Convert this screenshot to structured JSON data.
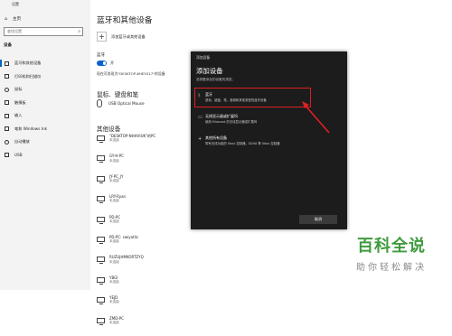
{
  "window": {
    "title": "设置"
  },
  "sidebar": {
    "home": "主页",
    "search_placeholder": "查找设置",
    "section": "设备",
    "items": [
      {
        "label": "蓝牙和其他设备",
        "active": true
      },
      {
        "label": "打印机和扫描仪"
      },
      {
        "label": "鼠标"
      },
      {
        "label": "触摸板"
      },
      {
        "label": "输入"
      },
      {
        "label": "笔和 Windows Ink"
      },
      {
        "label": "自动播放"
      },
      {
        "label": "USB"
      }
    ]
  },
  "main": {
    "title": "蓝牙和其他设备",
    "add_device": "添加蓝牙或其他设备",
    "bluetooth_label": "蓝牙",
    "toggle_state": "开",
    "discoverable": "现在可发现为\"DESKTOP-6HE5S17\"的设备",
    "mouse_section": "鼠标、键盘和笔",
    "mouse_device": "USB Optical Mouse",
    "other_section": "其他设备",
    "devices": [
      {
        "name": "\"DESKTOP-NHHVIUK\"的PC",
        "status": "未连接"
      },
      {
        "name": "GY-H-PC",
        "status": "未连接"
      },
      {
        "name": "JY-PC_JY",
        "status": "未连接"
      },
      {
        "name": "LRY-Ryan",
        "status": "未连接"
      },
      {
        "name": "PD-PC",
        "status": "未连接"
      },
      {
        "name": "PD-PC: swiyatlic",
        "status": "未连接"
      },
      {
        "name": "RUZUJHMKORTZYQ",
        "status": "未连接"
      },
      {
        "name": "YBGI",
        "status": "未连接"
      },
      {
        "name": "YEJD",
        "status": "未连接"
      },
      {
        "name": "ZMD-PC",
        "status": "未连接"
      }
    ]
  },
  "dialog": {
    "title": "添加设备",
    "heading": "添加设备",
    "subtitle": "选择要添加的设备的类型。",
    "options": [
      {
        "icon": "bluetooth-icon",
        "name": "蓝牙",
        "desc": "鼠标、键盘、笔、音频和其他类型的蓝牙设备"
      },
      {
        "icon": "monitor-icon",
        "name": "无线显示器或扩展坞",
        "desc": "使用 Miracast 的无线显示器或扩展坞"
      },
      {
        "icon": "plus-icon",
        "name": "其他所有设备",
        "desc": "带有无线功能的 Xbox 控制器、DLNA 等 Xbox 控制器"
      }
    ],
    "cancel": "取消"
  },
  "watermark": {
    "main": "百科全说",
    "sub": "助你轻松解决"
  },
  "colors": {
    "accent": "#0a62d0",
    "dialog_bg": "#1c1c1c",
    "highlight": "#e02020",
    "watermark": "#3e9b3e"
  }
}
